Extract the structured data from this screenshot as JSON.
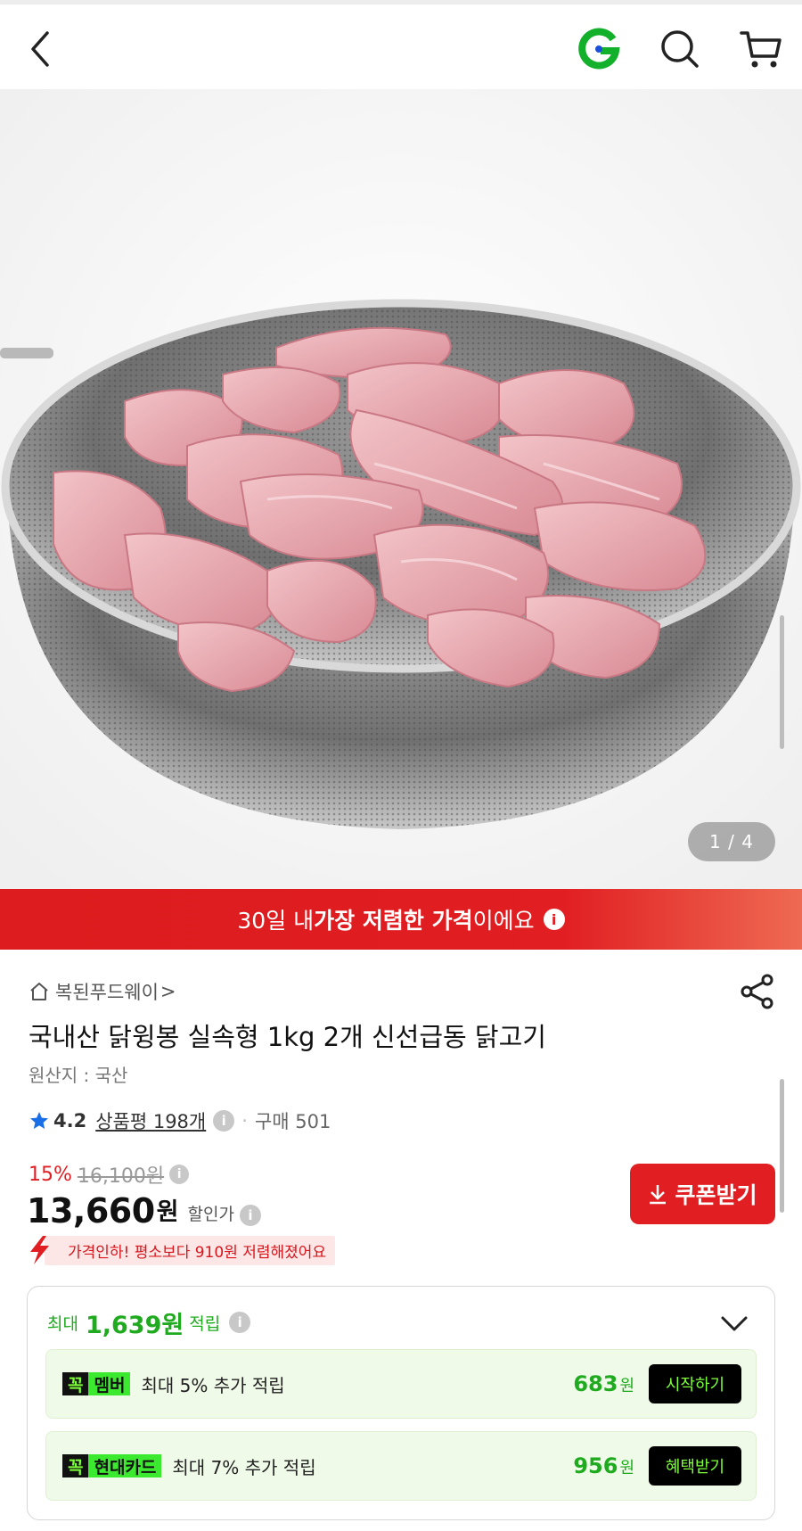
{
  "pager": {
    "text": "1 / 4"
  },
  "banner": {
    "pre": "30일 내 ",
    "bold": "가장 저렴한 가격",
    "post": "이에요",
    "info": "i"
  },
  "seller": {
    "name": "복된푸드웨이",
    "arrow": ">"
  },
  "product": {
    "title": "국내산 닭윙봉 실속형 1kg 2개 신선급동 닭고기",
    "origin": "원산지 : 국산"
  },
  "rating": {
    "score": "4.2",
    "reviews": "상품평 198개",
    "separator": "·",
    "purchases": "구매 501",
    "info": "i"
  },
  "price": {
    "discount_pct": "15%",
    "original": "16,100원",
    "sale": "13,660",
    "currency": "원",
    "label": "할인가",
    "info": "i"
  },
  "coupon": {
    "label": "쿠폰받기"
  },
  "price_drop": {
    "text": "가격인하! 평소보다 910원 저렴해졌어요"
  },
  "reward": {
    "prefix": "최대",
    "amount": "1,639원",
    "suffix": "적립",
    "info": "i",
    "offers": [
      {
        "badge_k": "꼭",
        "badge_name": "멤버",
        "desc": "최대 5% 추가 적립",
        "value": "683",
        "unit": "원",
        "action": "시작하기"
      },
      {
        "badge_k": "꼭",
        "badge_name": "현대카드",
        "desc": "최대 7% 추가 적립",
        "value": "956",
        "unit": "원",
        "action": "혜택받기"
      }
    ]
  },
  "colors": {
    "accent_red": "#e11e22",
    "reward_green": "#1faa1f",
    "neon_green": "#3bea2e",
    "logo_green": "#12b02b"
  },
  "icons": [
    "back-arrow-icon",
    "g-logo-icon",
    "search-icon",
    "cart-icon",
    "home-icon",
    "share-icon",
    "star-icon",
    "info-icon",
    "download-icon",
    "chevron-down-icon",
    "lightning-icon"
  ]
}
